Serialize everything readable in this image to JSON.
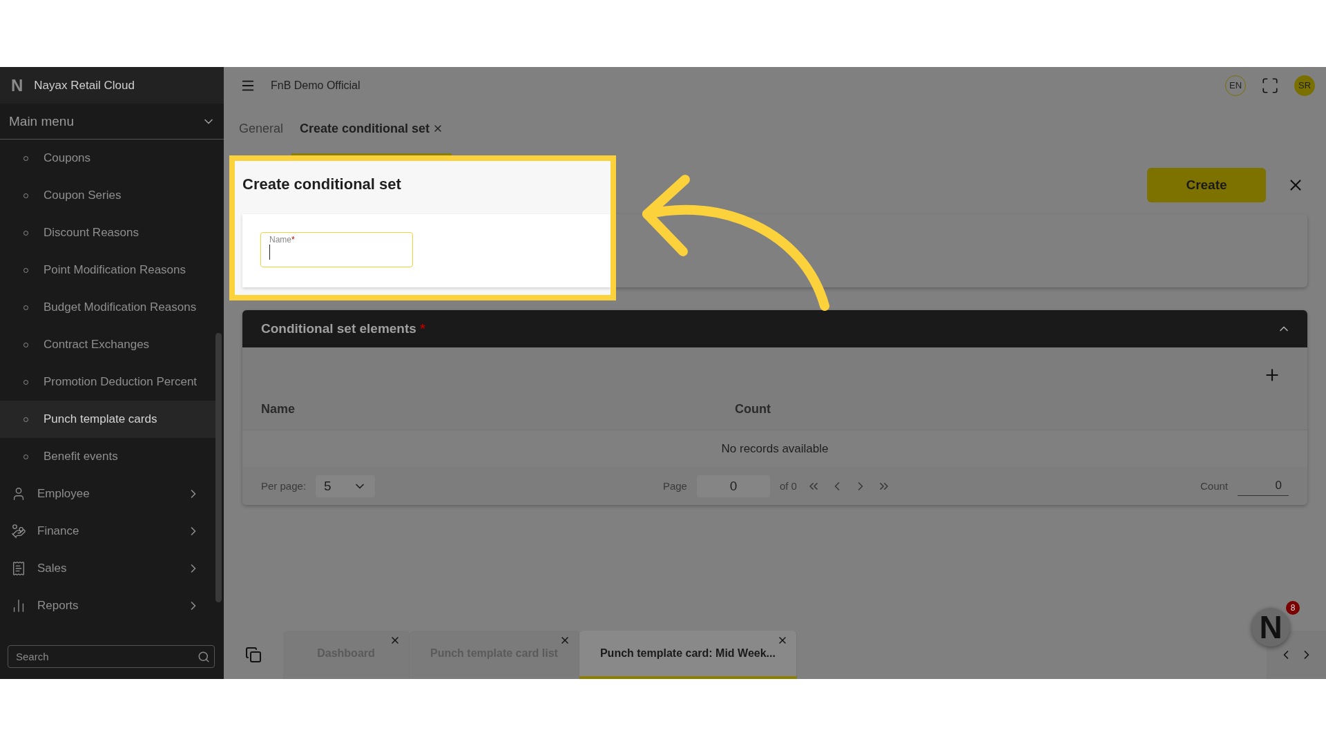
{
  "sidebar": {
    "brand_mark": "N",
    "brand": "Nayax Retail Cloud",
    "menu_title": "Main menu",
    "sub_items": [
      {
        "label": "Coupons",
        "selected": false
      },
      {
        "label": "Coupon Series",
        "selected": false
      },
      {
        "label": "Discount Reasons",
        "selected": false
      },
      {
        "label": "Point Modification Reasons",
        "selected": false
      },
      {
        "label": "Budget Modification Reasons",
        "selected": false
      },
      {
        "label": "Contract Exchanges",
        "selected": false
      },
      {
        "label": "Promotion Deduction Percent",
        "selected": false
      },
      {
        "label": "Punch template cards",
        "selected": true
      },
      {
        "label": "Benefit events",
        "selected": false
      }
    ],
    "groups": [
      {
        "label": "Employee",
        "kind": "person"
      },
      {
        "label": "Finance",
        "kind": "money"
      },
      {
        "label": "Sales",
        "kind": "receipt"
      },
      {
        "label": "Reports",
        "kind": "chart"
      }
    ],
    "search": {
      "placeholder": "Search"
    }
  },
  "header": {
    "title": "FnB Demo Official",
    "language": "EN",
    "avatar": "SR"
  },
  "tabs": [
    {
      "label": "General",
      "selected": false,
      "closable": false
    },
    {
      "label": "Create conditional set",
      "selected": true,
      "closable": true
    }
  ],
  "form": {
    "title": "Create conditional set",
    "name_field": {
      "label": "Name",
      "required_mark": "*"
    },
    "create_button": "Create"
  },
  "elements": {
    "title": "Conditional set elements",
    "required_mark": "*",
    "expanded": true,
    "columns": [
      "Name",
      "Count"
    ],
    "empty_text": "No records available",
    "pagination": {
      "per_page_label": "Per page:",
      "per_page": "5",
      "page_label": "Page",
      "page": "0",
      "of": "of 0",
      "count_label": "Count",
      "count": "0"
    }
  },
  "bottom_tabs": [
    {
      "label": "Dashboard",
      "selected": false
    },
    {
      "label": "Punch template card list",
      "selected": false
    },
    {
      "label": "Punch template card: Mid Week...",
      "selected": true
    }
  ],
  "notification": {
    "logo": "N",
    "badge": "8"
  }
}
